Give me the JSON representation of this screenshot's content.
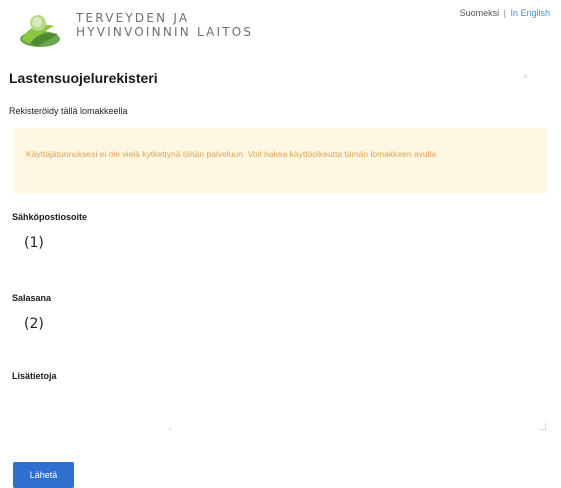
{
  "header": {
    "logo_line1": "TERVEYDEN JA",
    "logo_line2": "HYVINVOINNIN LAITOS",
    "lang_current": "Suomeksi",
    "lang_separator": "|",
    "lang_alt": "In English"
  },
  "page": {
    "title": "Lastensuojelurekisteri",
    "subtitle": "Rekisteröidy tällä lomakkeella"
  },
  "warning": {
    "text": "Käyttäjätunnuksesi ei ole vielä kytkettynä tähän palveluun. Voit hakea käyttöoikeutta tämän lomakkeen avulla"
  },
  "form": {
    "email_label": "Sähköpostiosoite",
    "email_value": "(1)",
    "name_label": "Salasana",
    "name_value": "(2)",
    "message_label": "Lisätietoja",
    "submit_label": "Lähetä"
  },
  "colors": {
    "accent": "#2e6fd0",
    "warning_bg": "#fdf7e3",
    "warning_text": "#e0a354",
    "link": "#4a90d9"
  }
}
